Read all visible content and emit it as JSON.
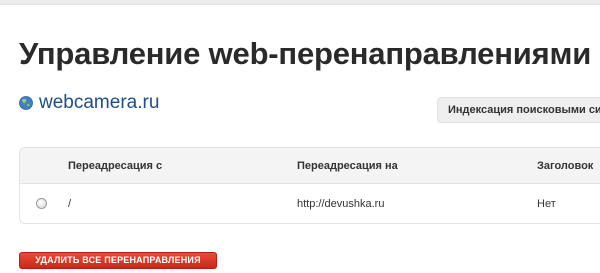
{
  "page": {
    "title": "Управление web-перенаправлениями"
  },
  "site": {
    "name": "webcamera.ru",
    "icon": "globe-icon"
  },
  "indexing_button": {
    "label": "Индексация поисковыми си"
  },
  "table": {
    "columns": [
      "Переадресация с",
      "Переадресация на",
      "Заголовок"
    ],
    "rows": [
      {
        "from": "/",
        "to": "http://devushka.ru",
        "header": "Нет"
      }
    ]
  },
  "actions": {
    "delete_all_label": "УДАЛИТЬ ВСЕ ПЕРЕНАПРАВЛЕНИЯ"
  }
}
